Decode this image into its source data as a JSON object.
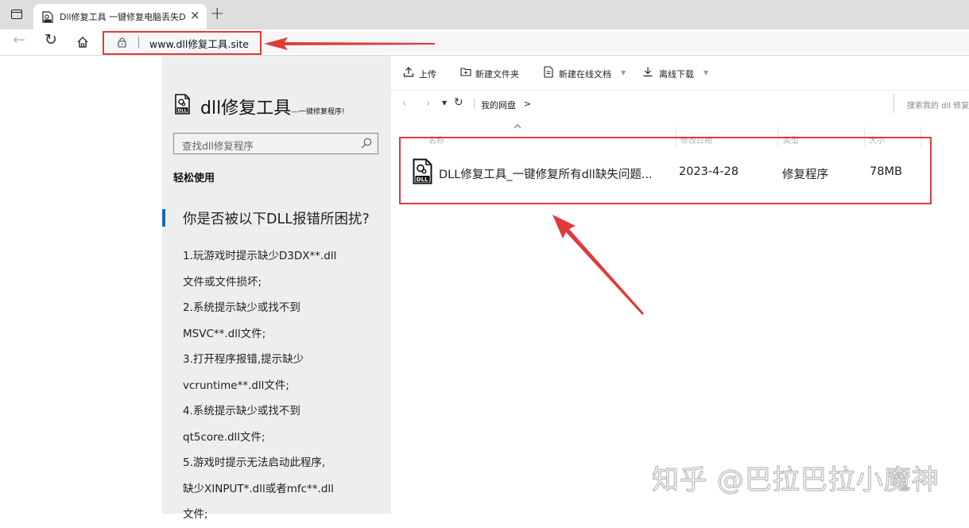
{
  "browser": {
    "tab_title": "Dll修复工具 一键修复电脑丢失D",
    "tab_close": "×",
    "new_tab": "+",
    "url": "www.dll修复工具.site"
  },
  "sidebar": {
    "logo_title": "dll修复工具",
    "logo_subtitle": "---一键修复程序!",
    "search_placeholder": "查找dll修复程序",
    "easy_use": "轻松使用",
    "question": "你是否被以下DLL报错所困扰?",
    "lines": [
      "1.玩游戏时提示缺少D3DX**.dll",
      "文件或文件损坏;",
      "2.系统提示缺少或找不到",
      "MSVC**.dll文件;",
      "3.打开程序报错,提示缺少",
      "vcruntime**.dll文件;",
      "4.系统提示缺少或找不到",
      "qt5core.dll文件;",
      "5.游戏时提示无法启动此程序,",
      "缺少XINPUT*.dll或者mfc**.dll",
      "文件;"
    ]
  },
  "drive": {
    "actions": {
      "upload": "上传",
      "new_folder": "新建文件夹",
      "new_online_doc": "新建在线文档",
      "offline_download": "离线下载"
    },
    "path_current": "我的网盘",
    "path_arrow": ">",
    "search_placeholder": "搜索我的 dll 修复",
    "columns": {
      "name": "名称",
      "modified": "修改日期",
      "type": "类型",
      "size": "大小"
    },
    "files": [
      {
        "name": "DLL修复工具_一键修复所有dll缺失问题...",
        "date": "2023-4-28",
        "type": "修复程序",
        "size": "78MB"
      }
    ]
  },
  "watermark": "知乎 @巴拉巴拉小魔神",
  "colors": {
    "annotation_red": "#e03b3b",
    "accent_blue": "#1b66c2",
    "sidebar_bg": "#eeeeee",
    "tabbar_bg": "#dedede"
  }
}
